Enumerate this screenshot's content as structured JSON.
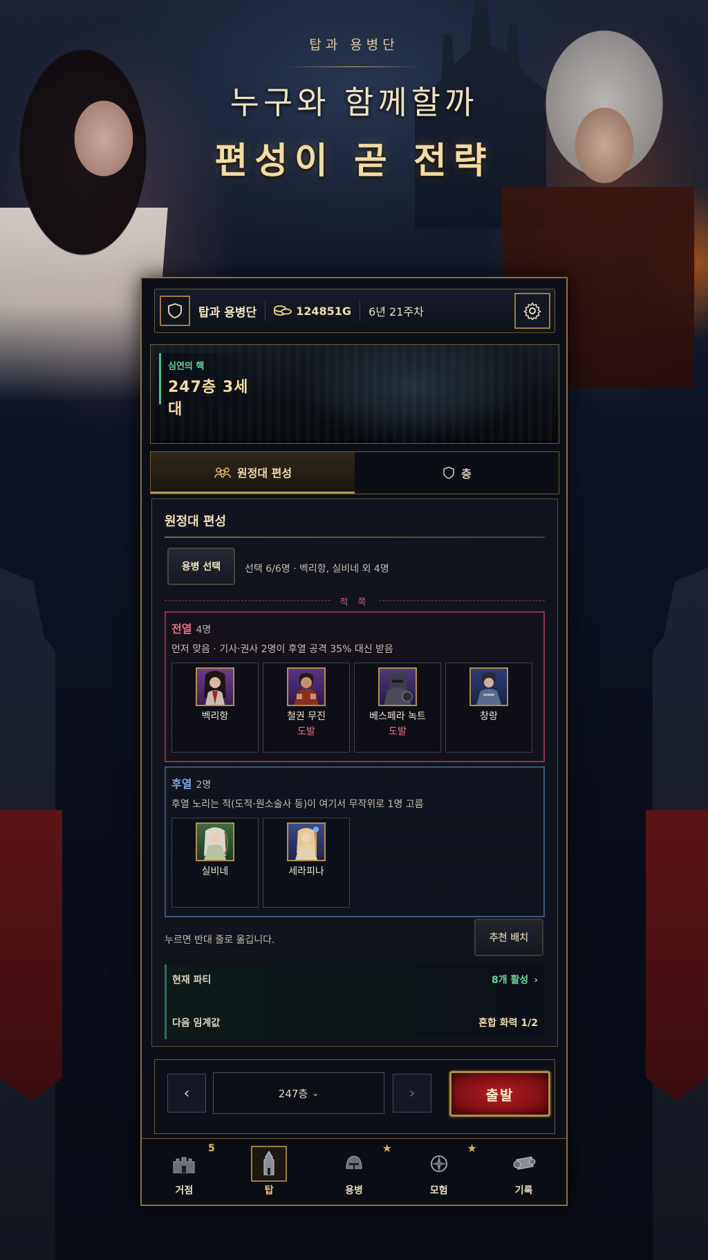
{
  "hero": {
    "subtitle": "탑과 용병단",
    "title_line1": "누구와 함께할까",
    "title_line2": "편성이 곧 전략"
  },
  "header": {
    "title": "탑과 용병단",
    "coins": "124851G",
    "week": "6년 21주차"
  },
  "floor_banner": {
    "label": "심연의 핵",
    "value": "247층 3세대"
  },
  "tabs": [
    {
      "label": "원정대 편성",
      "active": true
    },
    {
      "label": "층",
      "active": false
    }
  ],
  "panel": {
    "title": "원정대 편성",
    "merc_button": "용병 선택",
    "selection_info": "선택 6/6명 · 벡리항, 실비네 외 4명",
    "enemy_side": "적 쪽",
    "front_row": {
      "name": "전열",
      "count": "4명",
      "description": "먼저 맞음 · 기사·권사 2명이 후열 공격 35% 대신 받음",
      "members": [
        {
          "name": "벡리항",
          "tag": ""
        },
        {
          "name": "철권 무진",
          "tag": "도발"
        },
        {
          "name": "베스페라 녹트",
          "tag": "도발"
        },
        {
          "name": "창랑",
          "tag": ""
        }
      ]
    },
    "back_row": {
      "name": "후열",
      "count": "2명",
      "description": "후열 노리는 적(도적·원소술사 등)이 여기서 무작위로 1명 고름",
      "members": [
        {
          "name": "실비네",
          "tag": ""
        },
        {
          "name": "세라피나",
          "tag": ""
        }
      ]
    },
    "hint": "누르면 반대 줄로 옮깁니다.",
    "recommend_button": "추천 배치",
    "summary": {
      "current_party_label": "현재 파티",
      "current_party_value": "8개 활성",
      "next_threshold_label": "다음 임계값",
      "next_threshold_value": "혼합 화력 1/2"
    }
  },
  "control": {
    "prev_icon": "chevron-left-icon",
    "next_icon": "chevron-right-icon",
    "floor_select": "247층",
    "depart_button": "출발"
  },
  "bottom_nav": [
    {
      "label": "거점",
      "badge": "5",
      "icon": "castle-icon",
      "active": false
    },
    {
      "label": "탑",
      "badge": "",
      "icon": "tower-icon",
      "active": true
    },
    {
      "label": "용병",
      "badge": "★",
      "icon": "helmet-icon",
      "active": false
    },
    {
      "label": "모험",
      "badge": "★",
      "icon": "compass-icon",
      "active": false
    },
    {
      "label": "기록",
      "badge": "",
      "icon": "scroll-icon",
      "active": false
    }
  ],
  "colors": {
    "accent_gold": "#b6924f",
    "front_row": "#8a3348",
    "back_row": "#3c5480",
    "positive": "#6fd49a",
    "depart": "#b51e22"
  }
}
